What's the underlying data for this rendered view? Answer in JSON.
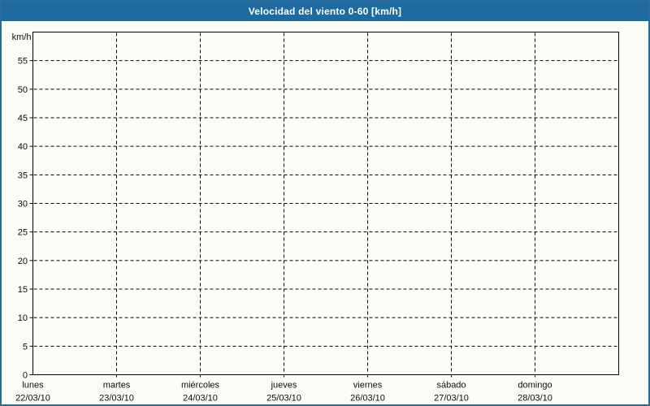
{
  "window": {
    "colors": {
      "frame_border": "#2b6b9e",
      "header_bg": "#1e6ba2",
      "header_text": "#ffffff",
      "background": "#fcfcf7",
      "plot_background": "#fcfcf7",
      "grid": "#000000",
      "axis": "#000000",
      "label_text": "#0b0b12"
    }
  },
  "header": {
    "title": "Velocidad del viento 0-60 [km/h]"
  },
  "chart_data": {
    "type": "line",
    "title": "Velocidad del viento 0-60 [km/h]",
    "ylabel": "km/h",
    "xlabel": "",
    "ylim": [
      0,
      60
    ],
    "yticks": [
      0,
      5,
      10,
      15,
      20,
      25,
      30,
      35,
      40,
      45,
      50,
      55
    ],
    "ytick_labels": [
      "0",
      "5",
      "10",
      "15",
      "20",
      "25",
      "30",
      "35",
      "40",
      "45",
      "50",
      "55"
    ],
    "grid": "dashed",
    "legend": "none",
    "days": [
      {
        "label": "lunes",
        "date": "22/03/10"
      },
      {
        "label": "martes",
        "date": "23/03/10"
      },
      {
        "label": "miércoles",
        "date": "24/03/10"
      },
      {
        "label": "jueves",
        "date": "25/03/10"
      },
      {
        "label": "viernes",
        "date": "26/03/10"
      },
      {
        "label": "sábado",
        "date": "27/03/10"
      },
      {
        "label": "domingo",
        "date": "28/03/10"
      }
    ],
    "series": []
  }
}
